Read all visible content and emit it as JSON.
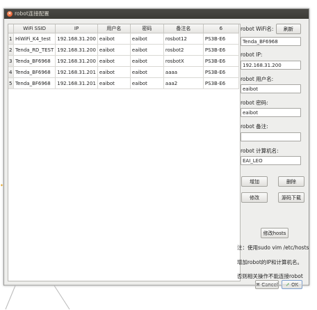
{
  "window": {
    "title": "robot连接配置"
  },
  "table": {
    "headers": [
      "WiFi SSID",
      "IP",
      "用户名",
      "密码",
      "备注名",
      "6"
    ],
    "rows": [
      {
        "num": "1",
        "cells": [
          "HiWiFi_K4_test",
          "192.168.31.200",
          "eaibot",
          "eaibot",
          "rosbot12",
          "PS3B-E6"
        ]
      },
      {
        "num": "2",
        "cells": [
          "Tenda_RD_TEST",
          "192.168.31.200",
          "eaibot",
          "eaibot",
          "rosbot2",
          "PS3B-E6"
        ]
      },
      {
        "num": "3",
        "cells": [
          "Tenda_BF6968",
          "192.168.31.200",
          "eaibot",
          "eaibot",
          "rosbotX",
          "PS3B-E6"
        ]
      },
      {
        "num": "4",
        "cells": [
          "Tenda_BF6968",
          "192.168.31.201",
          "eaibot",
          "eaibot",
          "aaaa",
          "PS3B-E6"
        ]
      },
      {
        "num": "5",
        "cells": [
          "Tenda_BF6968",
          "192.168.31.201",
          "eaibot",
          "eaibot",
          "aaa2",
          "PS3B-E6"
        ]
      }
    ]
  },
  "form": {
    "wifi_label": "robot WiFi名:",
    "refresh_button": "刷新",
    "wifi_value": "Tenda_BF6968",
    "ip_label": "robot IP:",
    "ip_value": "192.168.31.200",
    "user_label": "robot 用户名:",
    "user_value": "eaibot",
    "password_label": "robot 密码:",
    "password_value": "eaibot",
    "remark_label": "robot 备注:",
    "remark_value": "",
    "hostname_label": "robot 计算机名:",
    "hostname_value": "EAI_LEO"
  },
  "buttons": {
    "add": "增加",
    "delete": "删除",
    "modify": "修改",
    "download": "源码下载",
    "modify_hosts": "修改hosts",
    "cancel": "Cancel",
    "ok": "OK"
  },
  "notes": {
    "line1": "注：使用sudo vim /etc/hosts",
    "line2": "增加robot的IP和计算机名。",
    "line3": "否则相关操作不能连接robot"
  }
}
